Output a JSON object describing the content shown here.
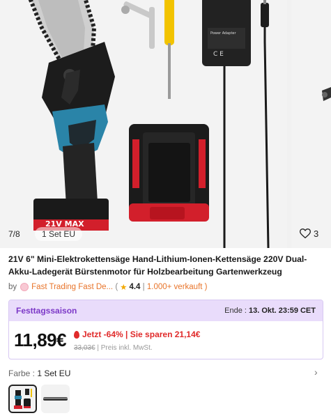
{
  "gallery": {
    "counter": "7/8",
    "variant_chip": "1 Set EU",
    "like_count": "3",
    "battery_label": "21V MAX"
  },
  "product": {
    "title": "21V 6\" Mini-Elektrokettensäge Hand-Lithium-Ionen-Kettensäge 220V Dual-Akku-Ladegerät Bürstenmotor für Holzbearbeitung Gartenwerkzeug"
  },
  "seller": {
    "prefix": "by",
    "name": "Fast Trading Fast De...",
    "rating": "4.4",
    "sold": "1.000+ verkauft"
  },
  "deal": {
    "name": "Festtagssaison",
    "ends_label": "Ende :",
    "ends_date": "13. Okt. 23:59 CET",
    "price": "11,89€",
    "discount": "Jetzt -64% | Sie sparen 21,14€",
    "old_price": "33,03€",
    "price_note": "| Preis inkl. MwSt."
  },
  "variant": {
    "label": "Farbe :",
    "value": "1 Set EU"
  },
  "colors": {
    "accent_purple": "#7c38c7",
    "deal_bg": "#e9dcfb",
    "discount_red": "#e02a2a",
    "seller_orange": "#e8742a"
  }
}
